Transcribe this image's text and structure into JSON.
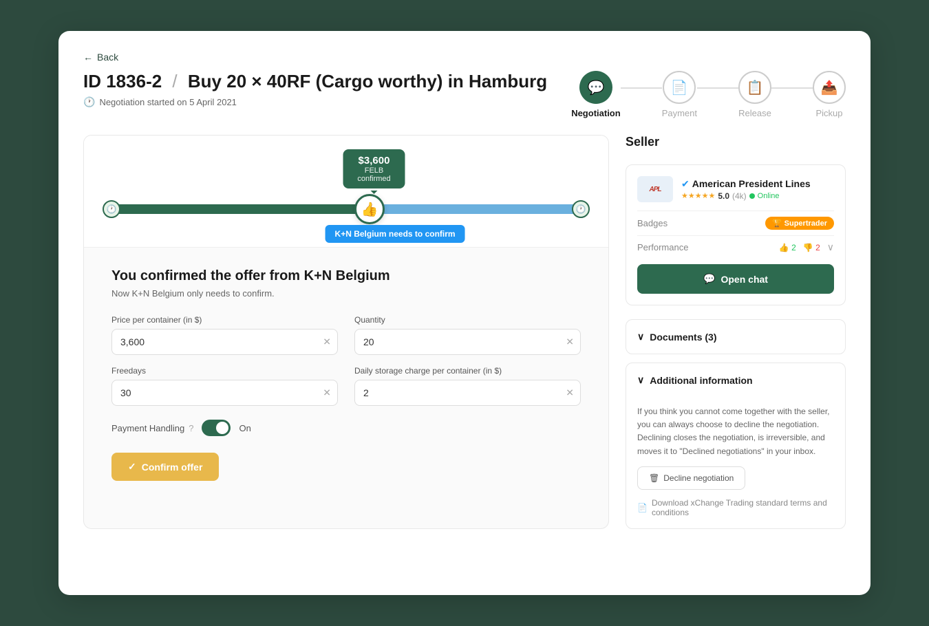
{
  "back": {
    "label": "Back"
  },
  "header": {
    "id": "ID 1836-2",
    "separator": "/",
    "title": "Buy 20 × 40RF (Cargo worthy) in Hamburg",
    "subtitle": "Negotiation started on 5 April 2021"
  },
  "steps": [
    {
      "label": "Negotiation",
      "state": "active",
      "icon": "💬"
    },
    {
      "label": "Payment",
      "state": "inactive",
      "icon": "📄"
    },
    {
      "label": "Release",
      "state": "inactive",
      "icon": "📋"
    },
    {
      "label": "Pickup",
      "state": "inactive",
      "icon": "📤"
    }
  ],
  "negotiation": {
    "price_bubble": {
      "price": "$3,600",
      "label1": "FELB",
      "label2": "confirmed"
    },
    "confirm_badge": "K+N Belgium needs to confirm"
  },
  "form": {
    "title": "You confirmed the offer from K+N Belgium",
    "subtitle": "Now K+N Belgium only needs to confirm.",
    "fields": {
      "price_label": "Price per container (in $)",
      "price_value": "3,600",
      "quantity_label": "Quantity",
      "quantity_value": "20",
      "freedays_label": "Freedays",
      "freedays_value": "30",
      "daily_label": "Daily storage charge per container (in $)",
      "daily_value": "2",
      "payment_label": "Payment Handling",
      "toggle_label": "On"
    },
    "confirm_btn": "Confirm offer"
  },
  "seller": {
    "section_label": "Seller",
    "company_name": "American President Lines",
    "company_name_online": "Online",
    "rating": "5.0",
    "rating_count": "(4k)",
    "badge_label": "Supertrader",
    "performance_label": "Performance",
    "perf_up": "2",
    "perf_down": "2",
    "open_chat_label": "Open chat"
  },
  "documents": {
    "label": "Documents (3)"
  },
  "additional_info": {
    "label": "Additional information",
    "content": "If you think you cannot come together with the seller, you can always choose to decline the negotiation. Declining closes the negotiation, is irreversible, and moves it to \"Declined negotiations\" in your inbox.",
    "decline_btn": "Decline negotiation",
    "download_link": "Download xChange Trading standard terms and conditions"
  },
  "icons": {
    "back_arrow": "←",
    "clock": "🕐",
    "chat_bubble": "💬",
    "document": "📄",
    "release": "📋",
    "pickup": "📤",
    "thumbs_up": "👍",
    "thumbs_down": "👎",
    "star": "★",
    "trophy": "🏆",
    "clear_x": "✕",
    "check": "✓",
    "trash": "🗑",
    "file": "📄",
    "chevron_down": "∨",
    "chat_icon": "💬",
    "verified": "✔"
  }
}
